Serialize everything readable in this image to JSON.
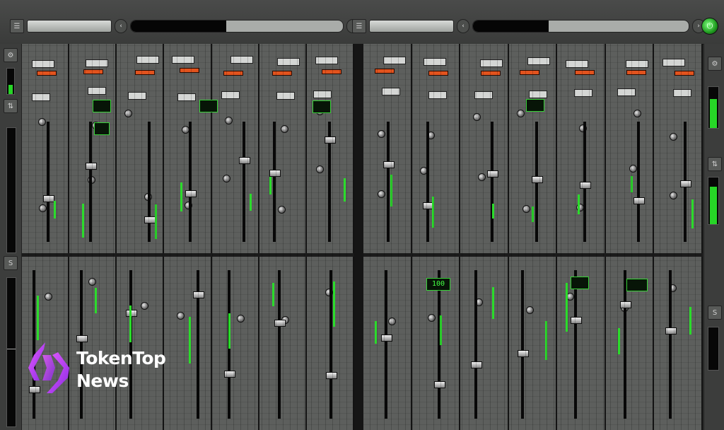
{
  "colors": {
    "accent_green": "#27d627",
    "lcd_green": "#45ff45",
    "warn_red": "#e2531e",
    "panel": "#5d5f5d",
    "watermark_magenta": "#c13bf2"
  },
  "toolbar": {
    "left_group": {
      "menu_icon": "menu-icon",
      "track_field": "",
      "nav_prev_icon": "chevron-left-icon",
      "nav_next_icon": "chevron-right-icon",
      "timeline_fill": 0.45
    },
    "right_group": {
      "menu_icon": "menu-icon",
      "track_field": "",
      "nav_prev_icon": "chevron-left-icon",
      "nav_next_icon": "chevron-right-icon",
      "timeline_fill": 0.35
    },
    "power_icon": "power-icon"
  },
  "left_meter": {
    "top_level": 0.35,
    "main_level": 0.0
  },
  "right_meter": {
    "top_level": 0.7,
    "low_level": 0.8
  },
  "mixer": {
    "left_bank_strips": 7,
    "right_bank_strips": 7,
    "displays": [
      "100"
    ]
  },
  "watermark": {
    "line1": "TokenTop",
    "line2": "News",
    "logo_icon": "tokentop-logo-icon"
  }
}
